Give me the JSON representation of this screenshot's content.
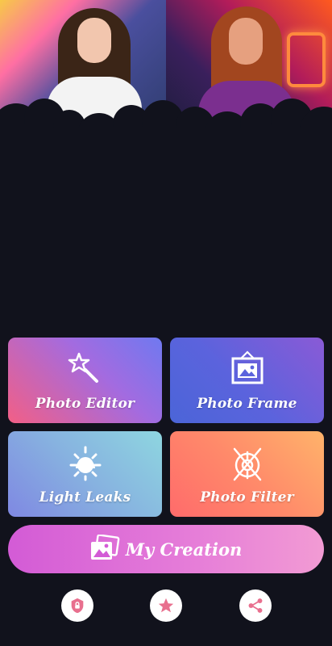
{
  "banner": {
    "images": [
      "woman-neon-portrait",
      "woman-neon-sign-portrait"
    ]
  },
  "features": [
    {
      "label": "Photo Editor",
      "icon": "magic-wand-icon"
    },
    {
      "label": "Photo Frame",
      "icon": "picture-frame-icon"
    },
    {
      "label": "Light Leaks",
      "icon": "sun-icon"
    },
    {
      "label": "Photo Filter",
      "icon": "aperture-icon"
    }
  ],
  "creation": {
    "label": "My Creation",
    "icon": "photos-stack-icon"
  },
  "bottom_actions": [
    {
      "name": "privacy",
      "icon": "shield-lock-icon"
    },
    {
      "name": "rate",
      "icon": "star-icon"
    },
    {
      "name": "share",
      "icon": "share-icon"
    }
  ],
  "colors": {
    "background": "#11121c",
    "accent_pink": "#e86f8e",
    "creation_gradient": [
      "#d35bd6",
      "#f29bd4"
    ]
  }
}
